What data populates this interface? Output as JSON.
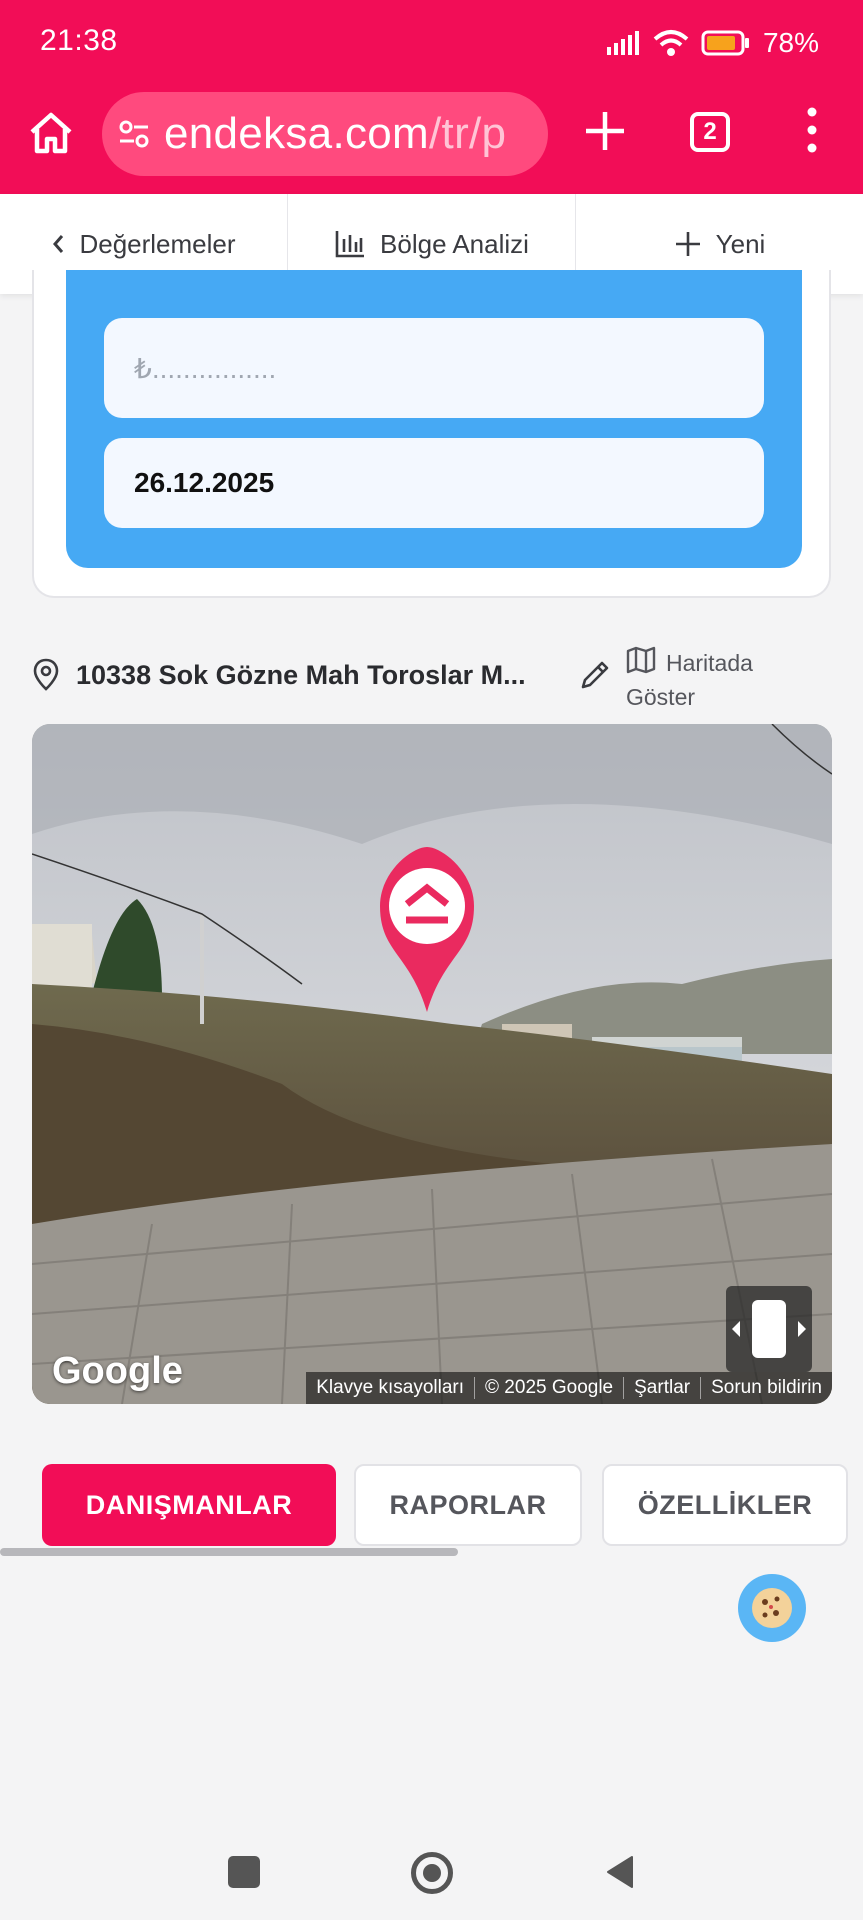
{
  "status_bar": {
    "time": "21:38",
    "battery_pct": "78%",
    "icons": [
      "signal-icon",
      "wifi-icon",
      "battery-icon"
    ]
  },
  "browser": {
    "url_main": "endeksa.com",
    "url_rest": "/tr/p",
    "tab_count": "2",
    "icons": [
      "home-icon",
      "site-settings-icon",
      "new-tab-icon",
      "tabs-icon",
      "overflow-menu-icon"
    ]
  },
  "app_nav": {
    "back_label": "Değerlemeler",
    "analysis_label": "Bölge Analizi",
    "new_label": "Yeni"
  },
  "form": {
    "price_placeholder": "₺................",
    "date_value": "26.12.2025"
  },
  "location": {
    "address": "10338 Sok Gözne Mah Toroslar M...",
    "map_label": "Haritada Göster"
  },
  "street_view": {
    "logo": "Google",
    "attribution": [
      "Klavye kısayolları",
      "© 2025 Google",
      "Şartlar",
      "Sorun bildirin"
    ]
  },
  "tabs": {
    "items": [
      "DANIŞMANLAR",
      "RAPORLAR",
      "ÖZELLİKLER"
    ],
    "active": "DANIŞMANLAR"
  },
  "colors": {
    "brand": "#f20d57",
    "card_blue": "#46a9f4",
    "page_bg": "#f4f4f5"
  }
}
